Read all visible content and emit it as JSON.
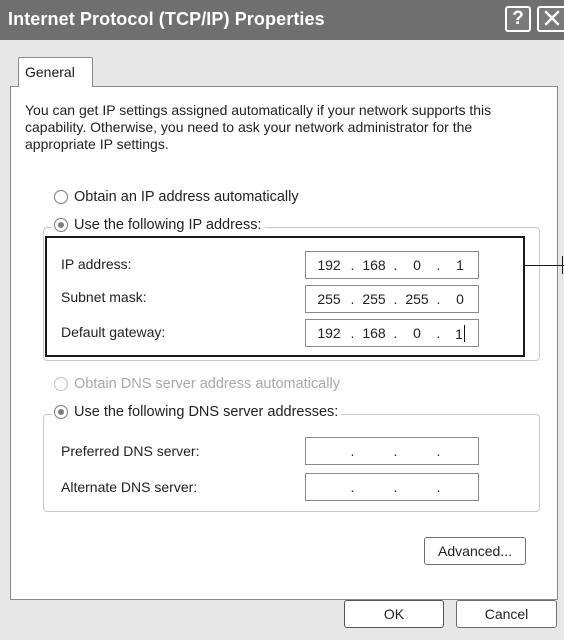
{
  "window": {
    "title": "Internet Protocol (TCP/IP) Properties",
    "help_label": "?",
    "close_icon": "close-icon"
  },
  "tabs": [
    {
      "label": "General",
      "selected": true
    }
  ],
  "description": "You can get IP settings assigned automatically if your network supports this capability. Otherwise, you need to ask your network administrator for the appropriate IP settings.",
  "ip_settings": {
    "auto_label": "Obtain an IP address automatically",
    "auto_checked": false,
    "manual_label": "Use the following IP address:",
    "manual_checked": true,
    "fields": [
      {
        "label": "IP address:",
        "octets": [
          "192",
          "168",
          "0",
          "1"
        ]
      },
      {
        "label": "Subnet mask:",
        "octets": [
          "255",
          "255",
          "255",
          "0"
        ]
      },
      {
        "label": "Default gateway:",
        "octets": [
          "192",
          "168",
          "0",
          "1"
        ],
        "has_caret": true
      }
    ]
  },
  "dns_settings": {
    "auto_label": "Obtain DNS server address automatically",
    "auto_enabled": false,
    "manual_label": "Use the following DNS server addresses:",
    "manual_checked": true,
    "fields": [
      {
        "label": "Preferred DNS server:",
        "octets": [
          "",
          "",
          "",
          ""
        ]
      },
      {
        "label": "Alternate DNS server:",
        "octets": [
          "",
          "",
          "",
          ""
        ]
      }
    ]
  },
  "buttons": {
    "advanced": "Advanced...",
    "ok": "OK",
    "cancel": "Cancel"
  },
  "colors": {
    "titlebar": "#6f6f6f",
    "window_bg": "#e7e7e7",
    "panel_bg": "#ffffff",
    "disabled_text": "#a8a8a8"
  }
}
